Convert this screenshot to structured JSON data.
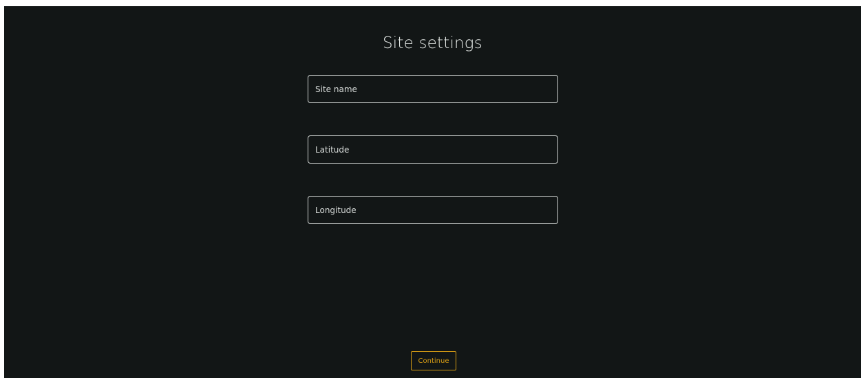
{
  "page": {
    "title": "Site settings"
  },
  "form": {
    "site_name": {
      "placeholder": "Site name",
      "value": ""
    },
    "latitude": {
      "placeholder": "Latitude",
      "value": ""
    },
    "longitude": {
      "placeholder": "Longitude",
      "value": ""
    }
  },
  "actions": {
    "continue_label": "Continue"
  },
  "colors": {
    "background": "#121616",
    "accent": "#d59b14",
    "text": "#e8ecea",
    "border": "#cfd3d1"
  }
}
